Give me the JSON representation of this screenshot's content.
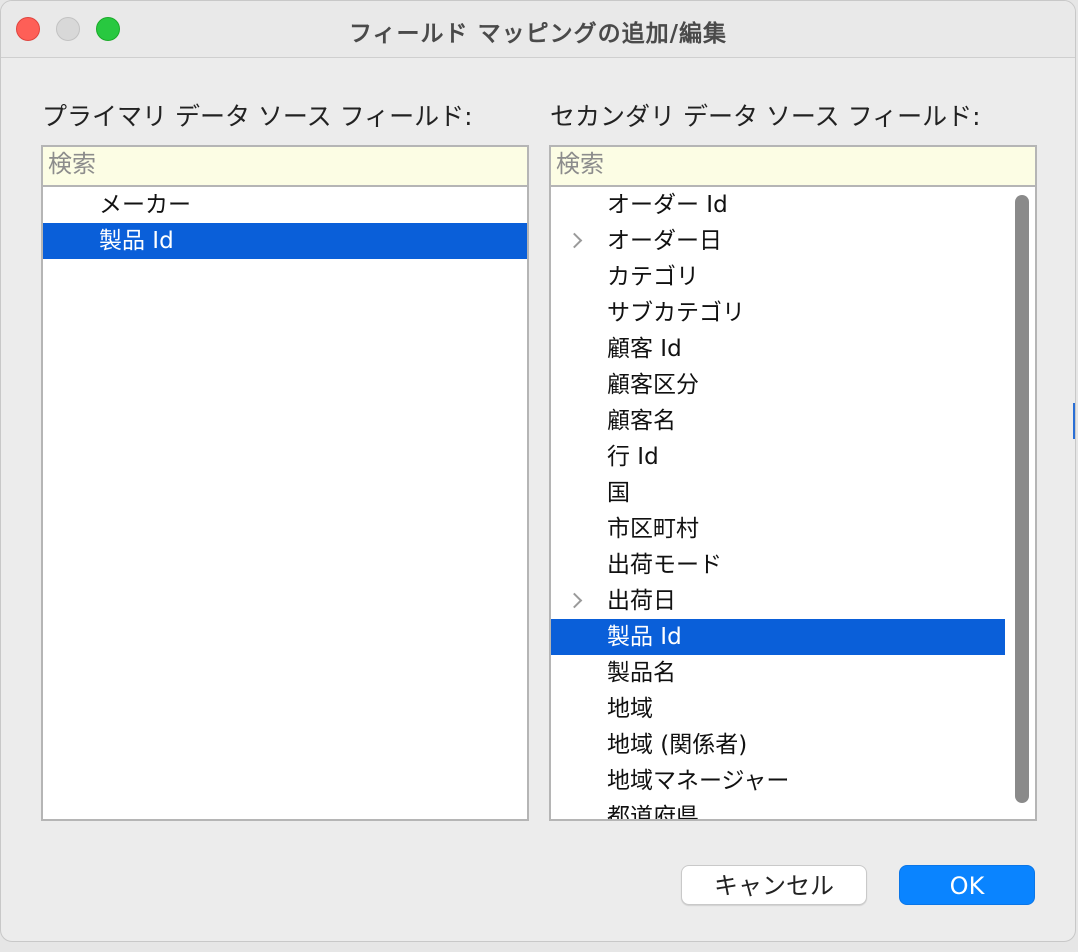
{
  "window": {
    "title": "フィールド マッピングの追加/編集"
  },
  "primary": {
    "label": "プライマリ データ ソース フィールド:",
    "search_placeholder": "検索",
    "items": [
      {
        "label": "メーカー"
      },
      {
        "label": "製品 Id",
        "selected": true
      }
    ]
  },
  "secondary": {
    "label": "セカンダリ データ ソース フィールド:",
    "search_placeholder": "検索",
    "items": [
      {
        "label": "オーダー Id"
      },
      {
        "label": "オーダー日",
        "expandable": true
      },
      {
        "label": "カテゴリ"
      },
      {
        "label": "サブカテゴリ"
      },
      {
        "label": "顧客 Id"
      },
      {
        "label": "顧客区分"
      },
      {
        "label": "顧客名"
      },
      {
        "label": "行 Id"
      },
      {
        "label": "国"
      },
      {
        "label": "市区町村"
      },
      {
        "label": "出荷モード"
      },
      {
        "label": "出荷日",
        "expandable": true
      },
      {
        "label": "製品 Id",
        "selected": true
      },
      {
        "label": "製品名"
      },
      {
        "label": "地域"
      },
      {
        "label": "地域 (関係者)"
      },
      {
        "label": "地域マネージャー"
      },
      {
        "label": "都道府県"
      }
    ]
  },
  "buttons": {
    "cancel": "キャンセル",
    "ok": "OK"
  },
  "colors": {
    "selection": "#0a5fd9",
    "ok_button": "#0a84ff",
    "search_bg": "#fcfde4",
    "close": "#fe5f57",
    "maximize": "#28c840"
  }
}
